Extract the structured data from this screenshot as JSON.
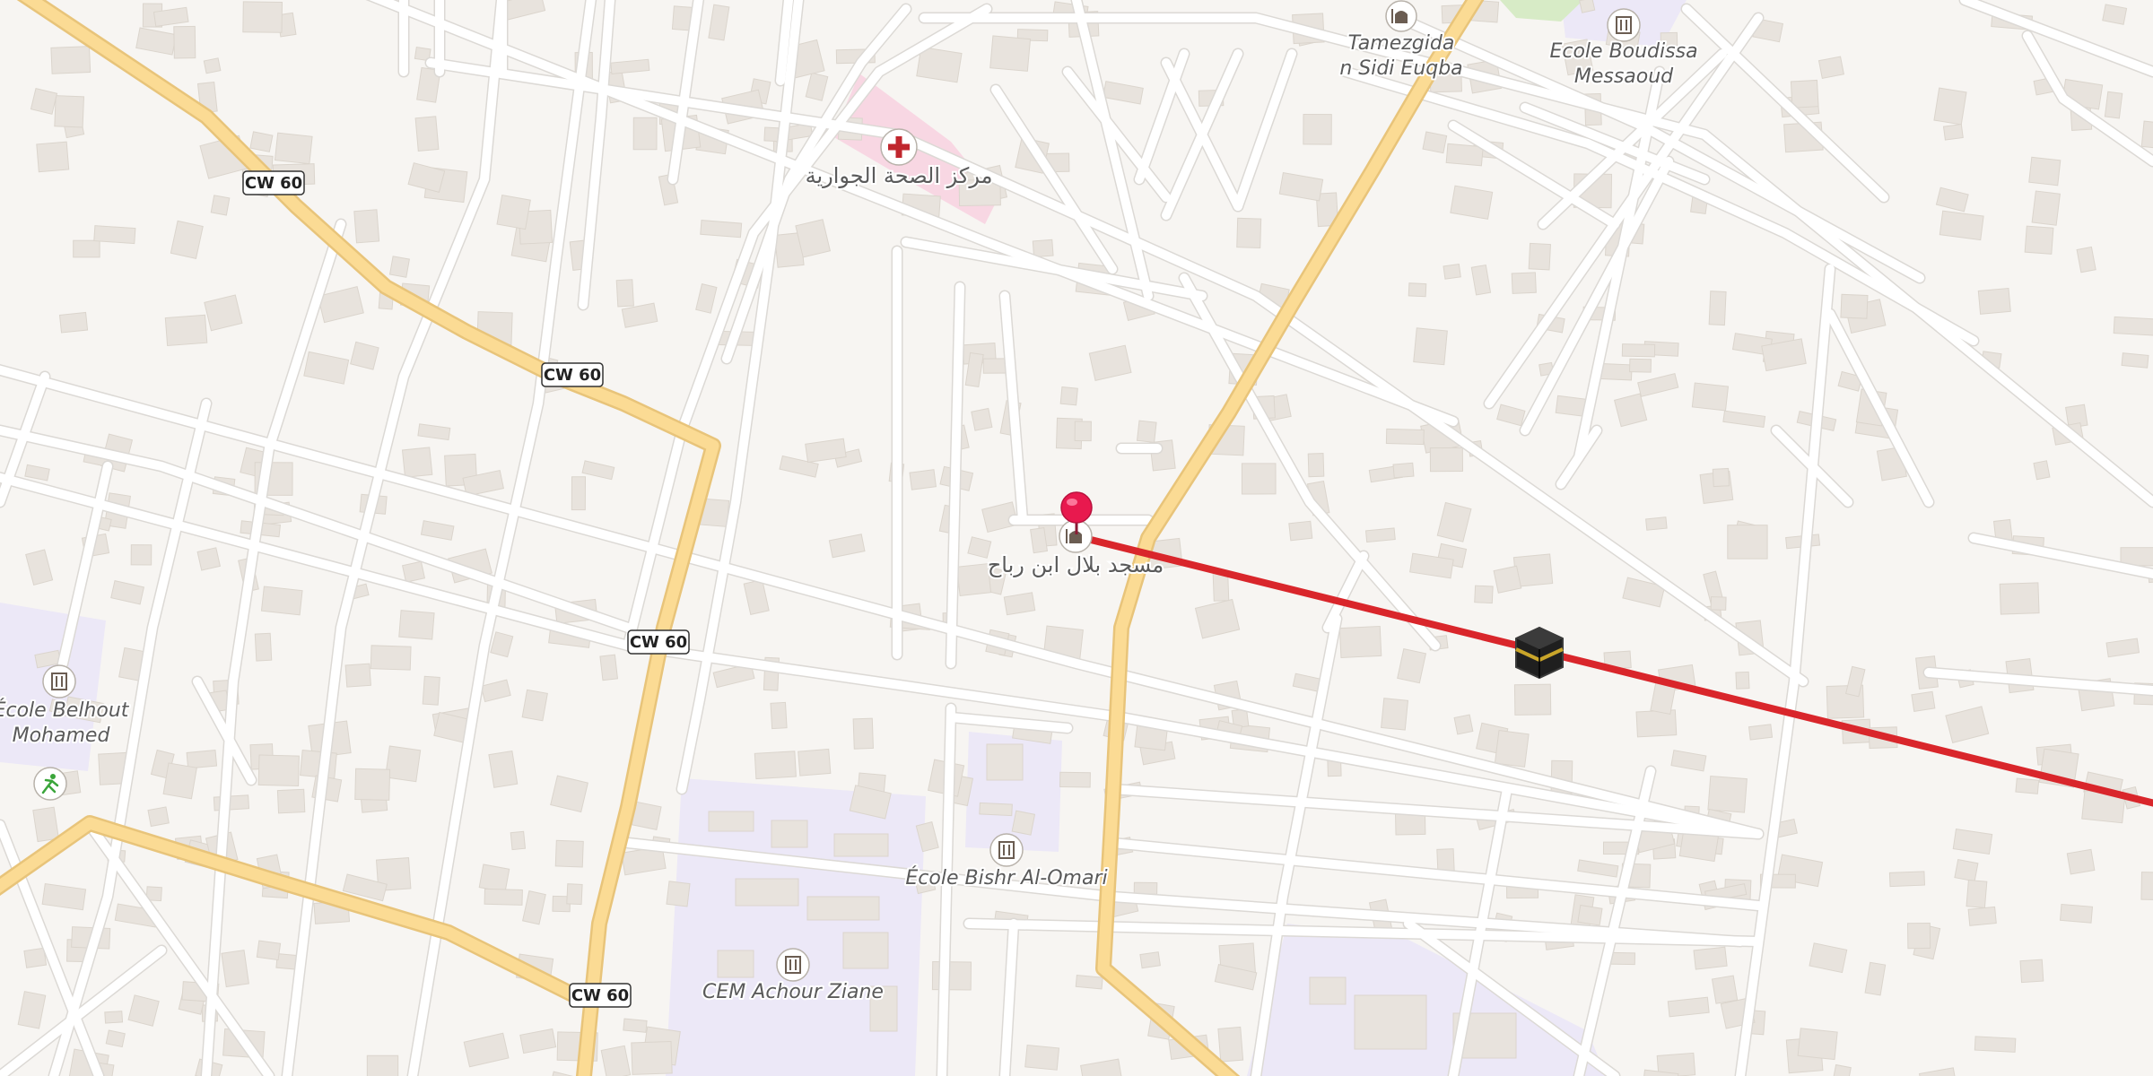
{
  "map": {
    "road_shields": [
      "CW 60",
      "CW 60",
      "CW 60",
      "CW 60"
    ],
    "pois": [
      {
        "name": "Tamezgida n Sidi Euqba",
        "line1": "Tamezgida",
        "line2": "n Sidi Euqba",
        "icon": "mosque-icon"
      },
      {
        "name": "Ecole Boudissa Messaoud",
        "line1": "Ecole Boudissa",
        "line2": "Messaoud",
        "icon": "school-icon"
      },
      {
        "name": "مركز الصحة الجوارية",
        "line1": "مركز الصحة الجوارية",
        "icon": "hospital-cross-icon"
      },
      {
        "name": "مسجد بلال ابن رباح",
        "line1": "مسجد بلال ابن رباح",
        "icon": "mosque-icon"
      },
      {
        "name": "École Belhout Mohamed",
        "line1": "École Belhout",
        "line2": "Mohamed",
        "icon": "school-icon"
      },
      {
        "name": "École Bishr Al-Omari",
        "line1": "École Bishr Al-Omari",
        "icon": "school-icon"
      },
      {
        "name": "CEM Achour Ziane",
        "line1": "CEM Achour Ziane",
        "icon": "school-icon"
      }
    ],
    "markers": {
      "location_pin": "map-pin-icon",
      "qibla_target": "kaaba-icon",
      "sports": "running-person-icon"
    },
    "colors": {
      "background": "#f7f5f2",
      "school_area": "#ece8f7",
      "hospital_area": "#f8d7e3",
      "major_road": "#fbdb94",
      "qibla_line": "#d9262b",
      "pin": "#e8194e"
    }
  }
}
